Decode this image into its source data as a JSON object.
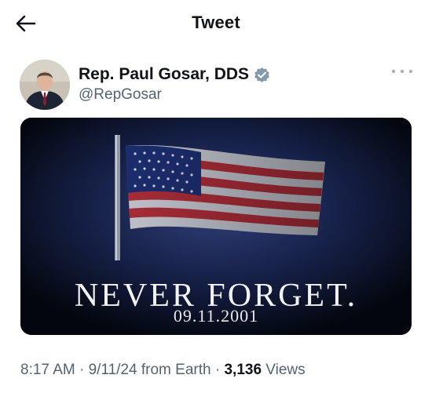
{
  "header": {
    "back_icon": "arrow-left-icon",
    "title": "Tweet"
  },
  "author": {
    "display_name": "Rep. Paul Gosar, DDS",
    "handle": "@RepGosar",
    "verified_icon": "verified-badge-icon",
    "verified_color": "#829aab",
    "more_icon": "more-horizontal-icon"
  },
  "media": {
    "headline": "NEVER FORGET.",
    "date": "09.11.2001"
  },
  "meta": {
    "time": "8:17 AM",
    "sep1": " · ",
    "date": "9/11/24",
    "source": " from Earth",
    "sep2": " · ",
    "views_count": "3,136",
    "views_label": " Views"
  }
}
